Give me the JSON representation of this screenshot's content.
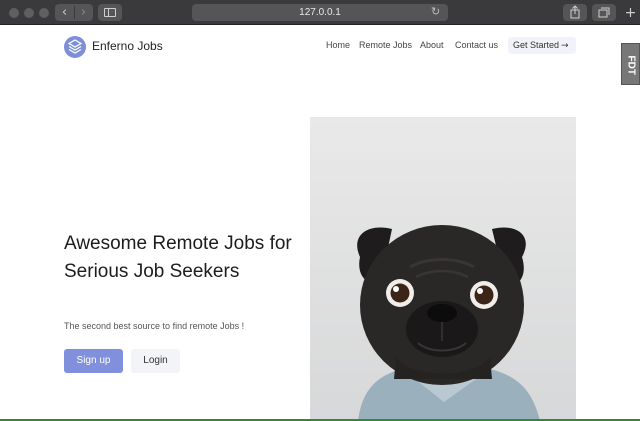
{
  "browser": {
    "url": "127.0.0.1"
  },
  "site": {
    "brand": "Enferno Jobs",
    "nav": [
      "Home",
      "Remote Jobs",
      "About",
      "Contact us"
    ],
    "cta_label": "Get Started",
    "debug_toolbar_label": "FDT"
  },
  "hero": {
    "title": "Awesome Remote Jobs for Serious Job Seekers",
    "subtitle": "The second best source to find remote Jobs !",
    "signup_label": "Sign up",
    "login_label": "Login"
  },
  "colors": {
    "accent": "#8090dc",
    "chrome": "#3a3a3c"
  }
}
